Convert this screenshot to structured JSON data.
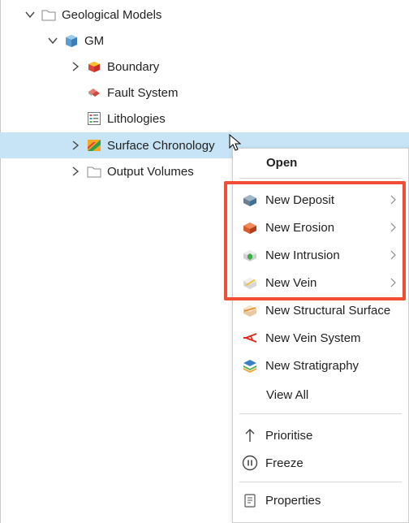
{
  "tree": {
    "geological_models": "Geological Models",
    "gm": "GM",
    "boundary": "Boundary",
    "fault_system": "Fault System",
    "lithologies": "Lithologies",
    "surface_chronology": "Surface Chronology",
    "output_volumes": "Output Volumes"
  },
  "menu": {
    "open": "Open",
    "new_deposit": "New Deposit",
    "new_erosion": "New Erosion",
    "new_intrusion": "New Intrusion",
    "new_vein": "New Vein",
    "new_structural_surface": "New Structural Surface",
    "new_vein_system": "New Vein System",
    "new_stratigraphy": "New Stratigraphy",
    "view_all": "View All",
    "prioritise": "Prioritise",
    "freeze": "Freeze",
    "properties": "Properties"
  },
  "colors": {
    "selection": "#c6e4f5",
    "highlight_box": "#f04e36"
  }
}
